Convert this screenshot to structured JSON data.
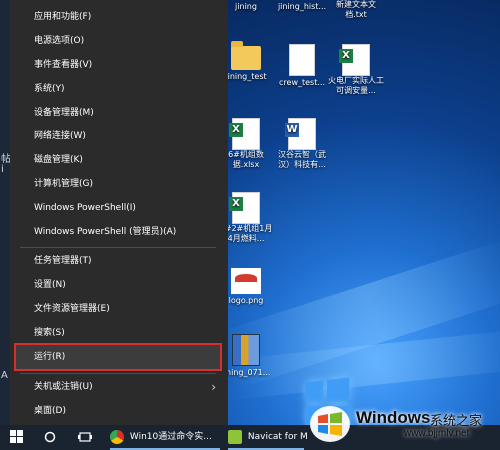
{
  "start_menu": {
    "items": [
      {
        "label": "应用和功能(F)"
      },
      {
        "label": "电源选项(O)"
      },
      {
        "label": "事件查看器(V)"
      },
      {
        "label": "系统(Y)"
      },
      {
        "label": "设备管理器(M)"
      },
      {
        "label": "网络连接(W)"
      },
      {
        "label": "磁盘管理(K)"
      },
      {
        "label": "计算机管理(G)"
      },
      {
        "label": "Windows PowerShell(I)"
      },
      {
        "label": "Windows PowerShell (管理员)(A)"
      },
      {
        "label": "任务管理器(T)"
      },
      {
        "label": "设置(N)"
      },
      {
        "label": "文件资源管理器(E)"
      },
      {
        "label": "搜索(S)"
      },
      {
        "label": "运行(R)",
        "highlighted": true
      },
      {
        "label": "关机或注销(U)",
        "has_submenu": true
      },
      {
        "label": "桌面(D)"
      }
    ]
  },
  "left_strip": {
    "chars": [
      "帖",
      "i",
      "A"
    ]
  },
  "desktop": {
    "icons": [
      {
        "label": "jining",
        "type": "folder"
      },
      {
        "label": "jining_hist...",
        "type": "folder"
      },
      {
        "label": "新建文本文档.txt",
        "type": "text"
      },
      {
        "label": "jining_test",
        "type": "folder"
      },
      {
        "label": "crew_test...",
        "type": "text"
      },
      {
        "label": "火电厂实际人工可调安量...",
        "type": "excel"
      },
      {
        "label": "6#机组数据.xlsx",
        "type": "excel"
      },
      {
        "label": "汉谷云智（武汉）科技有...",
        "type": "word"
      },
      {
        "label": "1#2#机组1月4月燃料...",
        "type": "excel"
      },
      {
        "label": "logo.png",
        "type": "image"
      },
      {
        "label": "jining_071...",
        "type": "archive"
      }
    ]
  },
  "taskbar": {
    "items": [
      {
        "label": "Win10通过命令实..."
      },
      {
        "label": "Navicat for M"
      }
    ]
  },
  "watermark": {
    "brand": "Windows",
    "suffix": "系统之家",
    "url": "www.bjjmlv.net"
  },
  "colors": {
    "menu_bg": "#2b2b2b",
    "highlight_border": "#d3302f",
    "taskbar_bg": "#1a2330",
    "desktop_blue": "#1f6fd0"
  }
}
